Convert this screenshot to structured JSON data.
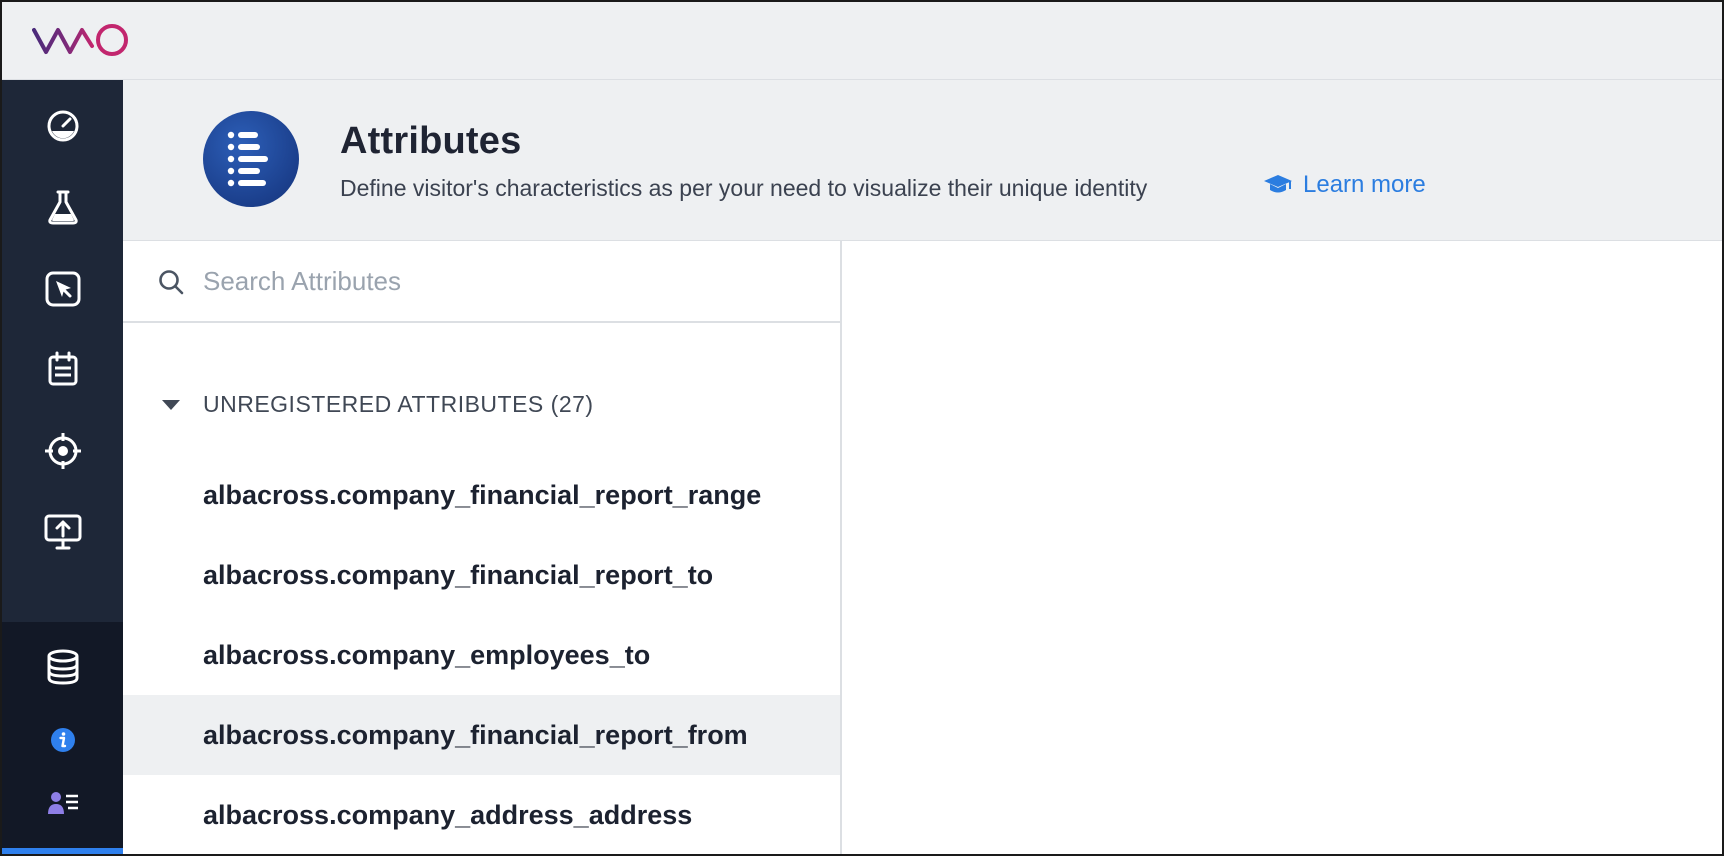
{
  "app": {
    "logo_text": "VWO"
  },
  "header": {
    "title": "Attributes",
    "description": "Define visitor's characteristics as per your need to visualize their unique identity",
    "learn_more": "Learn more"
  },
  "search": {
    "placeholder": "Search Attributes",
    "value": ""
  },
  "group": {
    "label": "UNREGISTERED ATTRIBUTES (27)"
  },
  "attributes": [
    {
      "name": "albacross.company_financial_report_range"
    },
    {
      "name": "albacross.company_financial_report_to"
    },
    {
      "name": "albacross.company_employees_to"
    },
    {
      "name": "albacross.company_financial_report_from"
    },
    {
      "name": "albacross.company_address_address"
    }
  ],
  "sidebar": {
    "items": [
      {
        "icon": "dashboard-gauge-icon"
      },
      {
        "icon": "flask-icon"
      },
      {
        "icon": "cursor-click-icon"
      },
      {
        "icon": "clipboard-icon"
      },
      {
        "icon": "target-icon"
      },
      {
        "icon": "presentation-upload-icon"
      },
      {
        "icon": "database-icon"
      },
      {
        "icon": "info-icon"
      },
      {
        "icon": "user-list-icon"
      }
    ]
  },
  "colors": {
    "sidebar": "#1e2738",
    "sidebar_active": "#121826",
    "accent": "#2b7de0",
    "header_bg": "#eef0f2"
  }
}
